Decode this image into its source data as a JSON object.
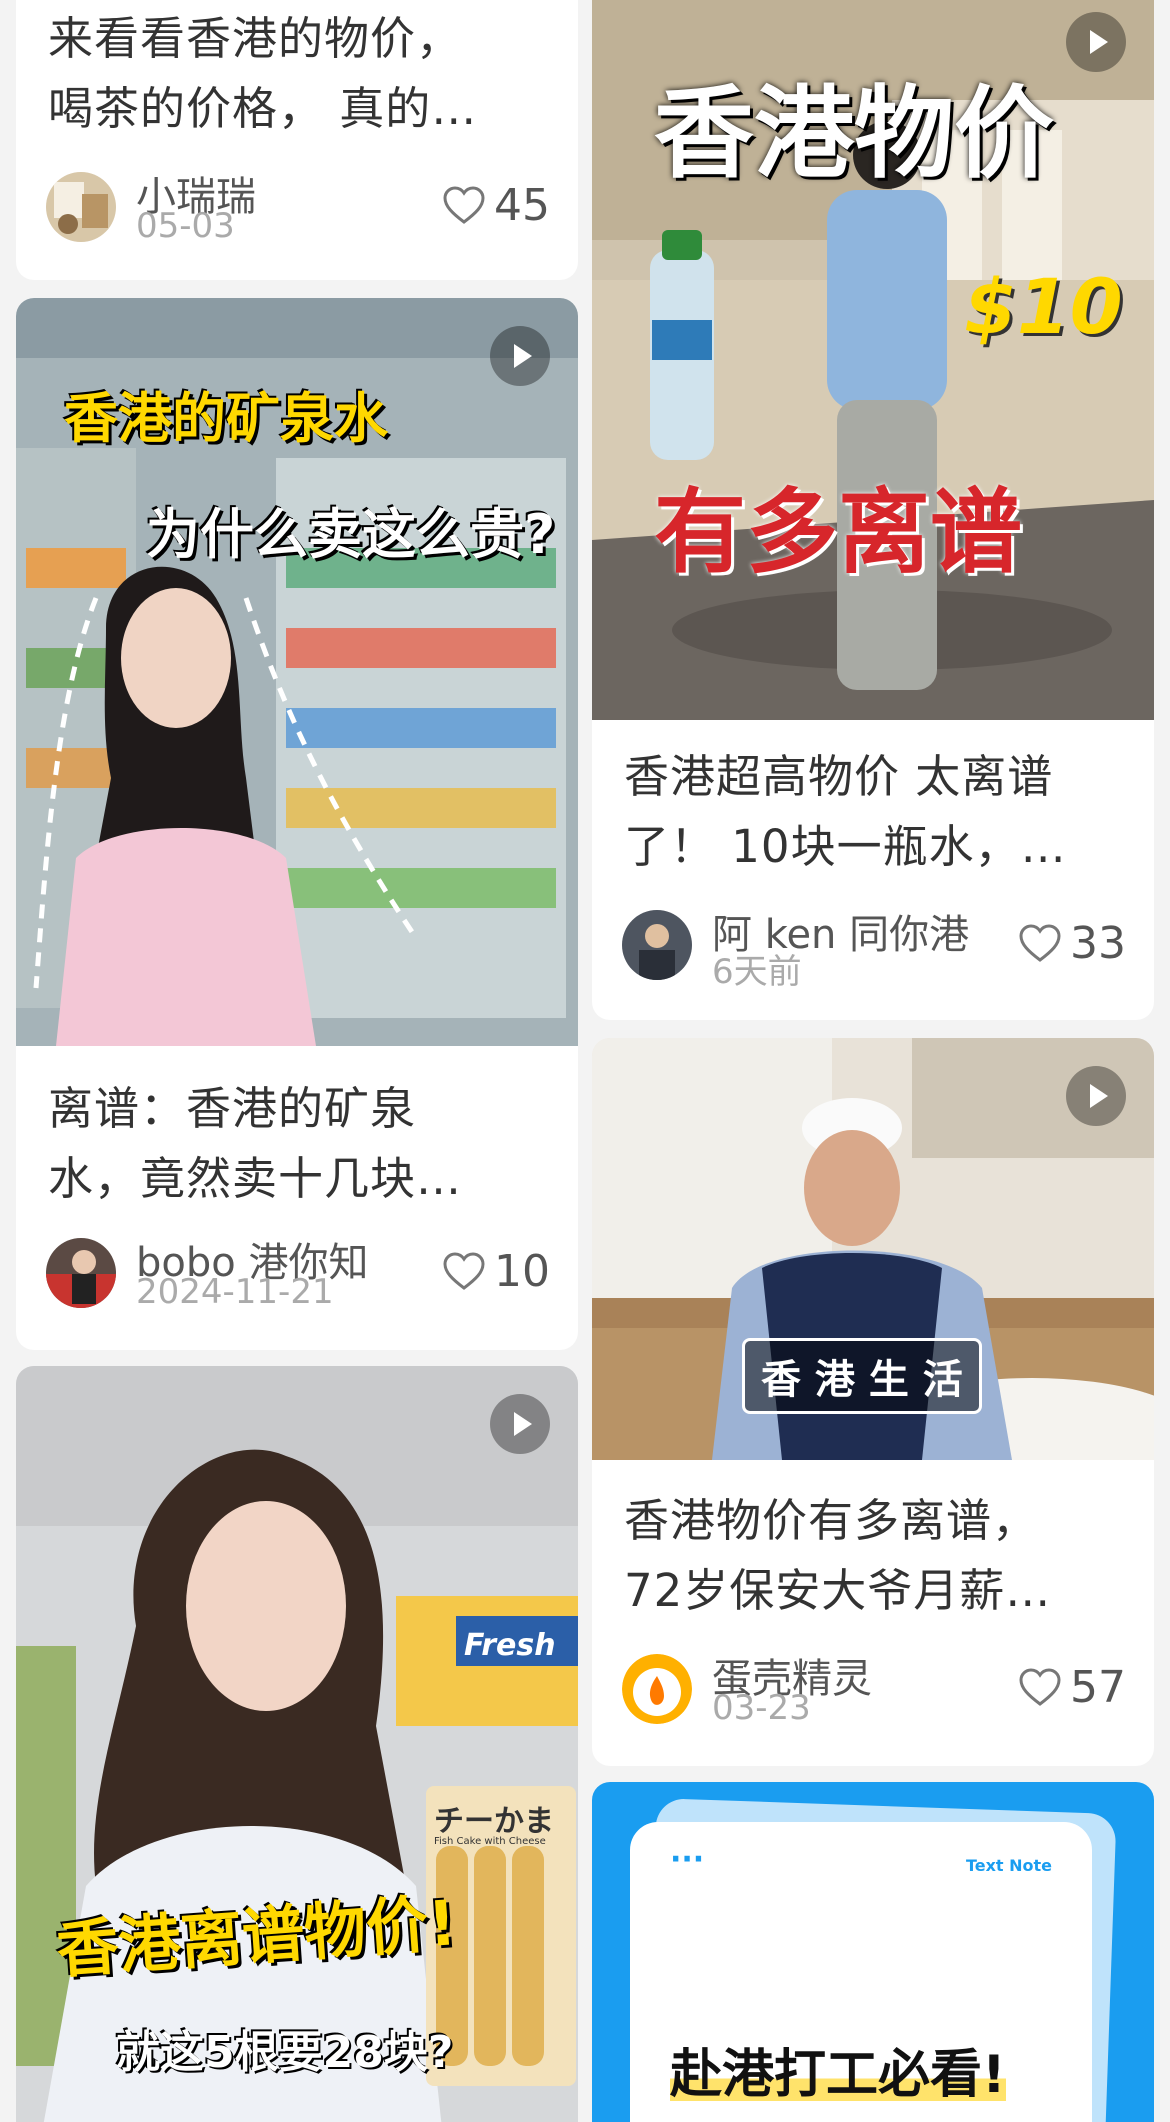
{
  "cards": [
    {
      "title": "来看看香港的物价，\n喝茶的价格，  真的…",
      "author": "小瑞瑞",
      "date": "05-03",
      "likes": "45"
    },
    {
      "title": "香港超高物价 太离谱\n了！  10块一瓶水，…",
      "author": "阿 ken 同你港",
      "date": "6天前",
      "likes": "33",
      "thumb_text": {
        "line1": "香港物价",
        "price": "$10",
        "line2": "有多离谱"
      }
    },
    {
      "title": "离谱：香港的矿泉\n水，竟然卖十几块…",
      "author": "bobo 港你知",
      "date": "2024-11-21",
      "likes": "10",
      "thumb_text": {
        "line1": "香港的矿泉水",
        "line2": "为什么卖这么贵?"
      }
    },
    {
      "title": "香港物价有多离谱，\n72岁保安大爷月薪…",
      "author": "蛋壳精灵",
      "date": "03-23",
      "likes": "57",
      "thumb_text": {
        "caption": "香 港 生 活"
      }
    },
    {
      "thumb_text": {
        "line1": "香港离谱物价!",
        "line2": "就这5根要28块?",
        "store": "Fresh",
        "pack_label": "チーかま",
        "pack_sub": "Fish Cake with Cheese"
      }
    },
    {
      "thumb_text": {
        "dots": "···",
        "tag": "Text Note",
        "headline": "赴港打工必看!"
      }
    }
  ],
  "colors": {
    "background": "#f3f3f3",
    "card": "#ffffff",
    "text": "#333333",
    "muted": "#aaaaaa",
    "accent_yellow": "#ffd800",
    "accent_red": "#d7262b",
    "note_blue": "#1a9df0"
  },
  "icons": [
    "heart-outline-icon",
    "play-icon"
  ]
}
